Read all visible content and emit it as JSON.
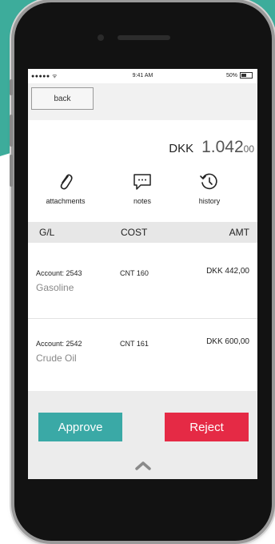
{
  "status_bar": {
    "signal": "●●●●● ᯤ",
    "time": "9:41 AM",
    "battery": "50%"
  },
  "nav": {
    "back_label": "back"
  },
  "total": {
    "currency": "DKK",
    "integer": "1.042",
    "decimals": "00"
  },
  "actions": [
    {
      "label": "attachments",
      "icon": "paperclip-icon"
    },
    {
      "label": "notes",
      "icon": "speech-bubble-icon"
    },
    {
      "label": "history",
      "icon": "history-clock-icon"
    }
  ],
  "table": {
    "headers": [
      "G/L",
      "COST",
      "AMT"
    ],
    "rows": [
      {
        "account": "Account: 2543",
        "description": "Gasoline",
        "cost": "CNT 160",
        "amount": "DKK 442,00"
      },
      {
        "account": "Account: 2542",
        "description": "Crude Oil",
        "cost": "CNT 161",
        "amount": "DKK 600,00"
      }
    ]
  },
  "footer": {
    "approve_label": "Approve",
    "reject_label": "Reject",
    "expand_icon": "chevron-up-icon"
  },
  "colors": {
    "backdrop": "#3dac9b",
    "approve": "#3aa9a6",
    "reject": "#e52a45"
  }
}
